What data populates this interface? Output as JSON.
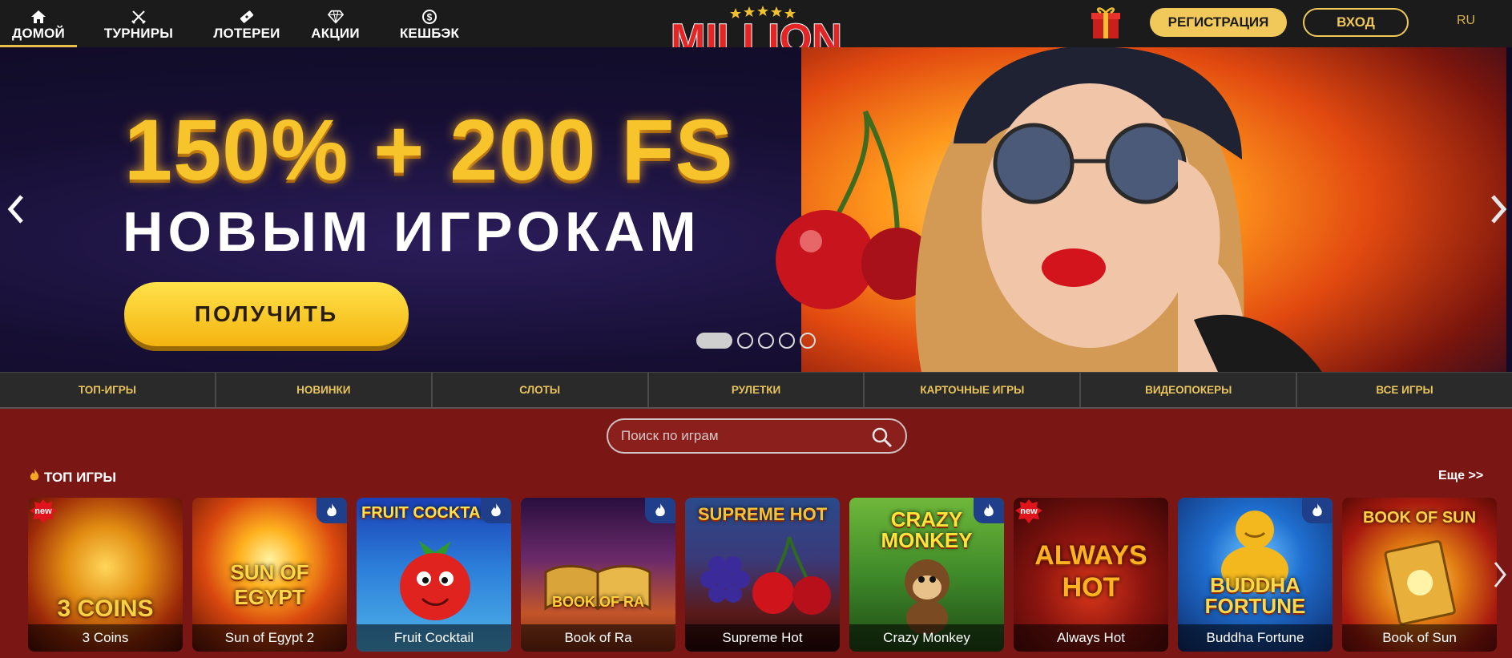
{
  "nav": {
    "items": [
      {
        "label": "ДОМОЙ",
        "icon": "home-icon",
        "active": true
      },
      {
        "label": "ТУРНИРЫ",
        "icon": "crossed-swords-icon"
      },
      {
        "label": "ЛОТЕРЕИ",
        "icon": "ticket-icon"
      },
      {
        "label": "АКЦИИ",
        "icon": "diamond-icon"
      },
      {
        "label": "КЕШБЭК",
        "icon": "coin-icon"
      }
    ]
  },
  "header": {
    "logo_text": "MILLION",
    "register_label": "РЕГИСТРАЦИЯ",
    "login_label": "ВХОД",
    "language": "RU",
    "accent_color": "#f0c95a"
  },
  "banner": {
    "headline": "150% + 200 FS",
    "subline": "НОВЫМ ИГРОКАМ",
    "cta_label": "ПОЛУЧИТЬ",
    "slides_count": 5,
    "active_slide": 1
  },
  "categories": [
    "ТОП-ИГРЫ",
    "НОВИНКИ",
    "СЛОТЫ",
    "РУЛЕТКИ",
    "КАРТОЧНЫЕ ИГРЫ",
    "ВИДЕОПОКЕРЫ",
    "ВСЕ ИГРЫ"
  ],
  "search": {
    "placeholder": "Поиск по играм"
  },
  "top_games": {
    "title": "ТОП ИГРЫ",
    "more_label": "Еще >>",
    "games": [
      {
        "title": "3 Coins",
        "badge": "new",
        "art_text": "3 COINS"
      },
      {
        "title": "Sun of Egypt 2",
        "badge": "fire",
        "art_text": "SUN OF EGYPT"
      },
      {
        "title": "Fruit Cocktail",
        "badge": "fire",
        "art_text": "FRUIT COCKTAIL"
      },
      {
        "title": "Book of Ra",
        "badge": "fire",
        "art_text": "BOOK OF RA"
      },
      {
        "title": "Supreme Hot",
        "badge": "none",
        "art_text": "SUPREME HOT"
      },
      {
        "title": "Crazy Monkey",
        "badge": "fire",
        "art_text": "CRAZY MONKEY"
      },
      {
        "title": "Always Hot",
        "badge": "new",
        "art_text": "ALWAYS HOT"
      },
      {
        "title": "Buddha Fortune",
        "badge": "fire",
        "art_text": "BUDDHA FORTUNE"
      },
      {
        "title": "Book of Sun",
        "badge": "none",
        "art_text": "BOOK OF SUN"
      }
    ]
  }
}
